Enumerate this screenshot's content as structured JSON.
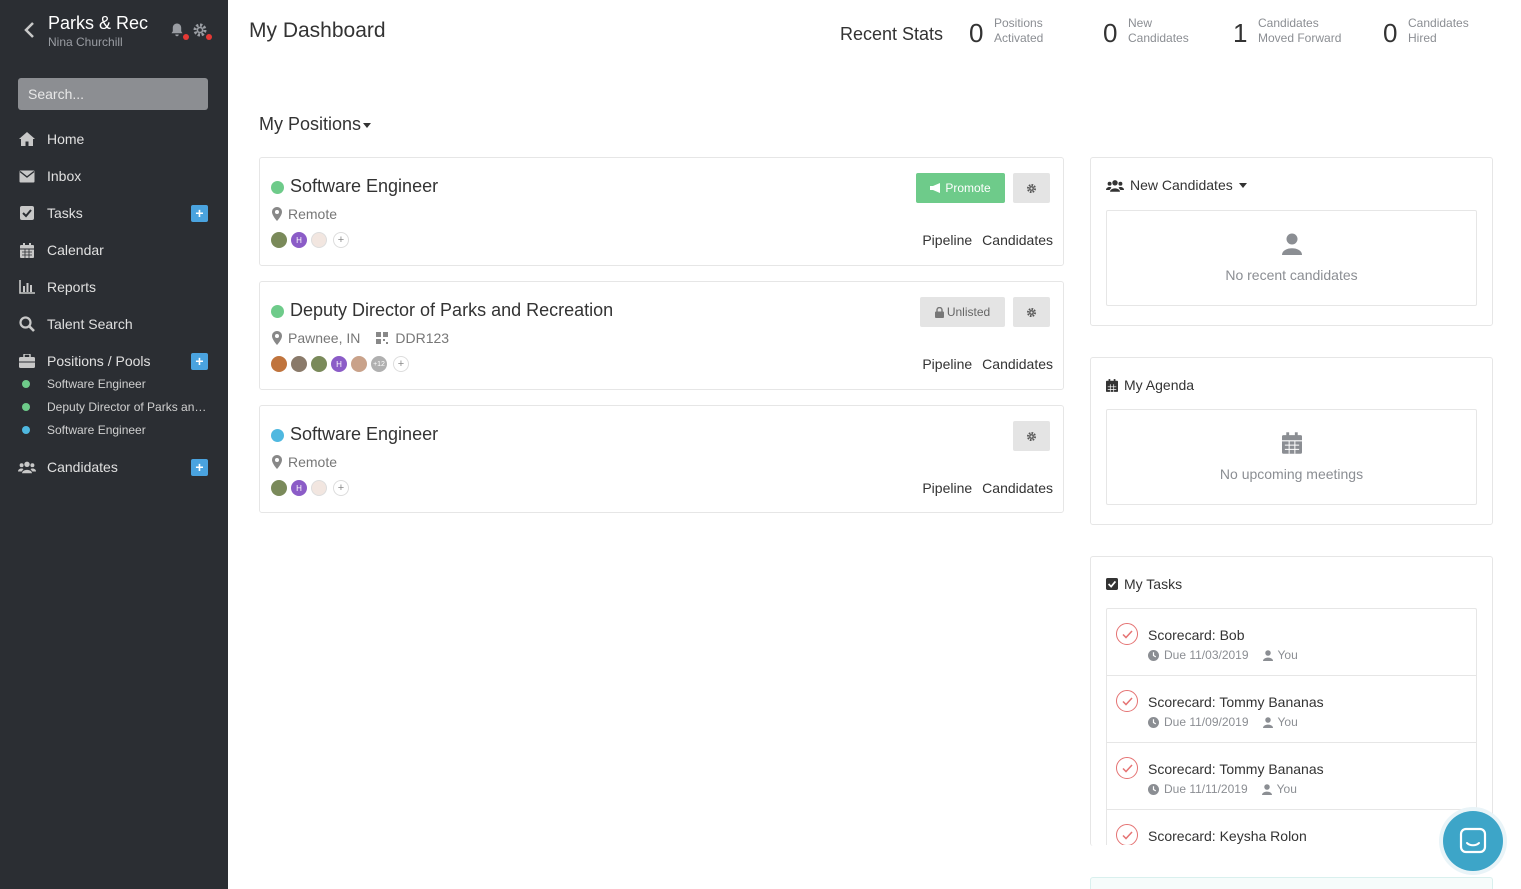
{
  "sidebar": {
    "org_name": "Parks & Rec",
    "user_name": "Nina Churchill",
    "search_placeholder": "Search...",
    "items": [
      {
        "label": "Home",
        "icon": "home-icon"
      },
      {
        "label": "Inbox",
        "icon": "inbox-icon"
      },
      {
        "label": "Tasks",
        "icon": "check-square-icon",
        "has_add": true
      },
      {
        "label": "Calendar",
        "icon": "calendar-icon"
      },
      {
        "label": "Reports",
        "icon": "bar-chart-icon"
      },
      {
        "label": "Talent Search",
        "icon": "search-icon"
      },
      {
        "label": "Positions / Pools",
        "icon": "briefcase-icon",
        "has_add": true
      },
      {
        "label": "Candidates",
        "icon": "users-icon",
        "has_add": true
      }
    ],
    "sub_items": [
      {
        "label": "Software Engineer",
        "color": "#6ecb8a"
      },
      {
        "label": "Deputy Director of Parks and Recreation",
        "color": "#6ecb8a"
      },
      {
        "label": "Software Engineer",
        "color": "#4fb8e0"
      }
    ],
    "add_label": "+"
  },
  "header": {
    "title": "My Dashboard",
    "stats_label": "Recent Stats",
    "stats": [
      {
        "value": "0",
        "line1": "Positions",
        "line2": "Activated"
      },
      {
        "value": "0",
        "line1": "New",
        "line2": "Candidates"
      },
      {
        "value": "1",
        "line1": "Candidates",
        "line2": "Moved Forward"
      },
      {
        "value": "0",
        "line1": "Candidates",
        "line2": "Hired"
      }
    ]
  },
  "positions": {
    "title": "My Positions",
    "cards": [
      {
        "title": "Software Engineer",
        "status_color": "#6ecb8a",
        "location": "Remote",
        "code": "",
        "button": "Promote",
        "avatar_overflow": "",
        "links": [
          "Pipeline",
          "Candidates"
        ]
      },
      {
        "title": "Deputy Director of Parks and Recreation",
        "status_color": "#6ecb8a",
        "location": "Pawnee, IN",
        "code": "DDR123",
        "button": "Unlisted",
        "avatar_overflow": "+12",
        "links": [
          "Pipeline",
          "Candidates"
        ]
      },
      {
        "title": "Software Engineer",
        "status_color": "#4fb8e0",
        "location": "Remote",
        "code": "",
        "button": "",
        "avatar_overflow": "",
        "links": [
          "Pipeline",
          "Candidates"
        ]
      }
    ],
    "avatar_initial": "H",
    "avatar_add": "+"
  },
  "new_candidates": {
    "title": "New Candidates",
    "empty_text": "No recent candidates"
  },
  "agenda": {
    "title": "My Agenda",
    "empty_text": "No upcoming meetings"
  },
  "tasks": {
    "title": "My Tasks",
    "items": [
      {
        "name": "Scorecard: Bob",
        "due": "Due 11/03/2019",
        "assignee": "You"
      },
      {
        "name": "Scorecard: Tommy Bananas",
        "due": "Due 11/09/2019",
        "assignee": "You"
      },
      {
        "name": "Scorecard: Tommy Bananas",
        "due": "Due 11/11/2019",
        "assignee": "You"
      },
      {
        "name": "Scorecard: Keysha Rolon",
        "due": "",
        "assignee": ""
      }
    ]
  },
  "colors": {
    "sidebar_bg": "#2b2e33",
    "accent_blue": "#4aa3df",
    "active_green": "#6ecb8a",
    "chat_blue": "#3da5c8"
  }
}
